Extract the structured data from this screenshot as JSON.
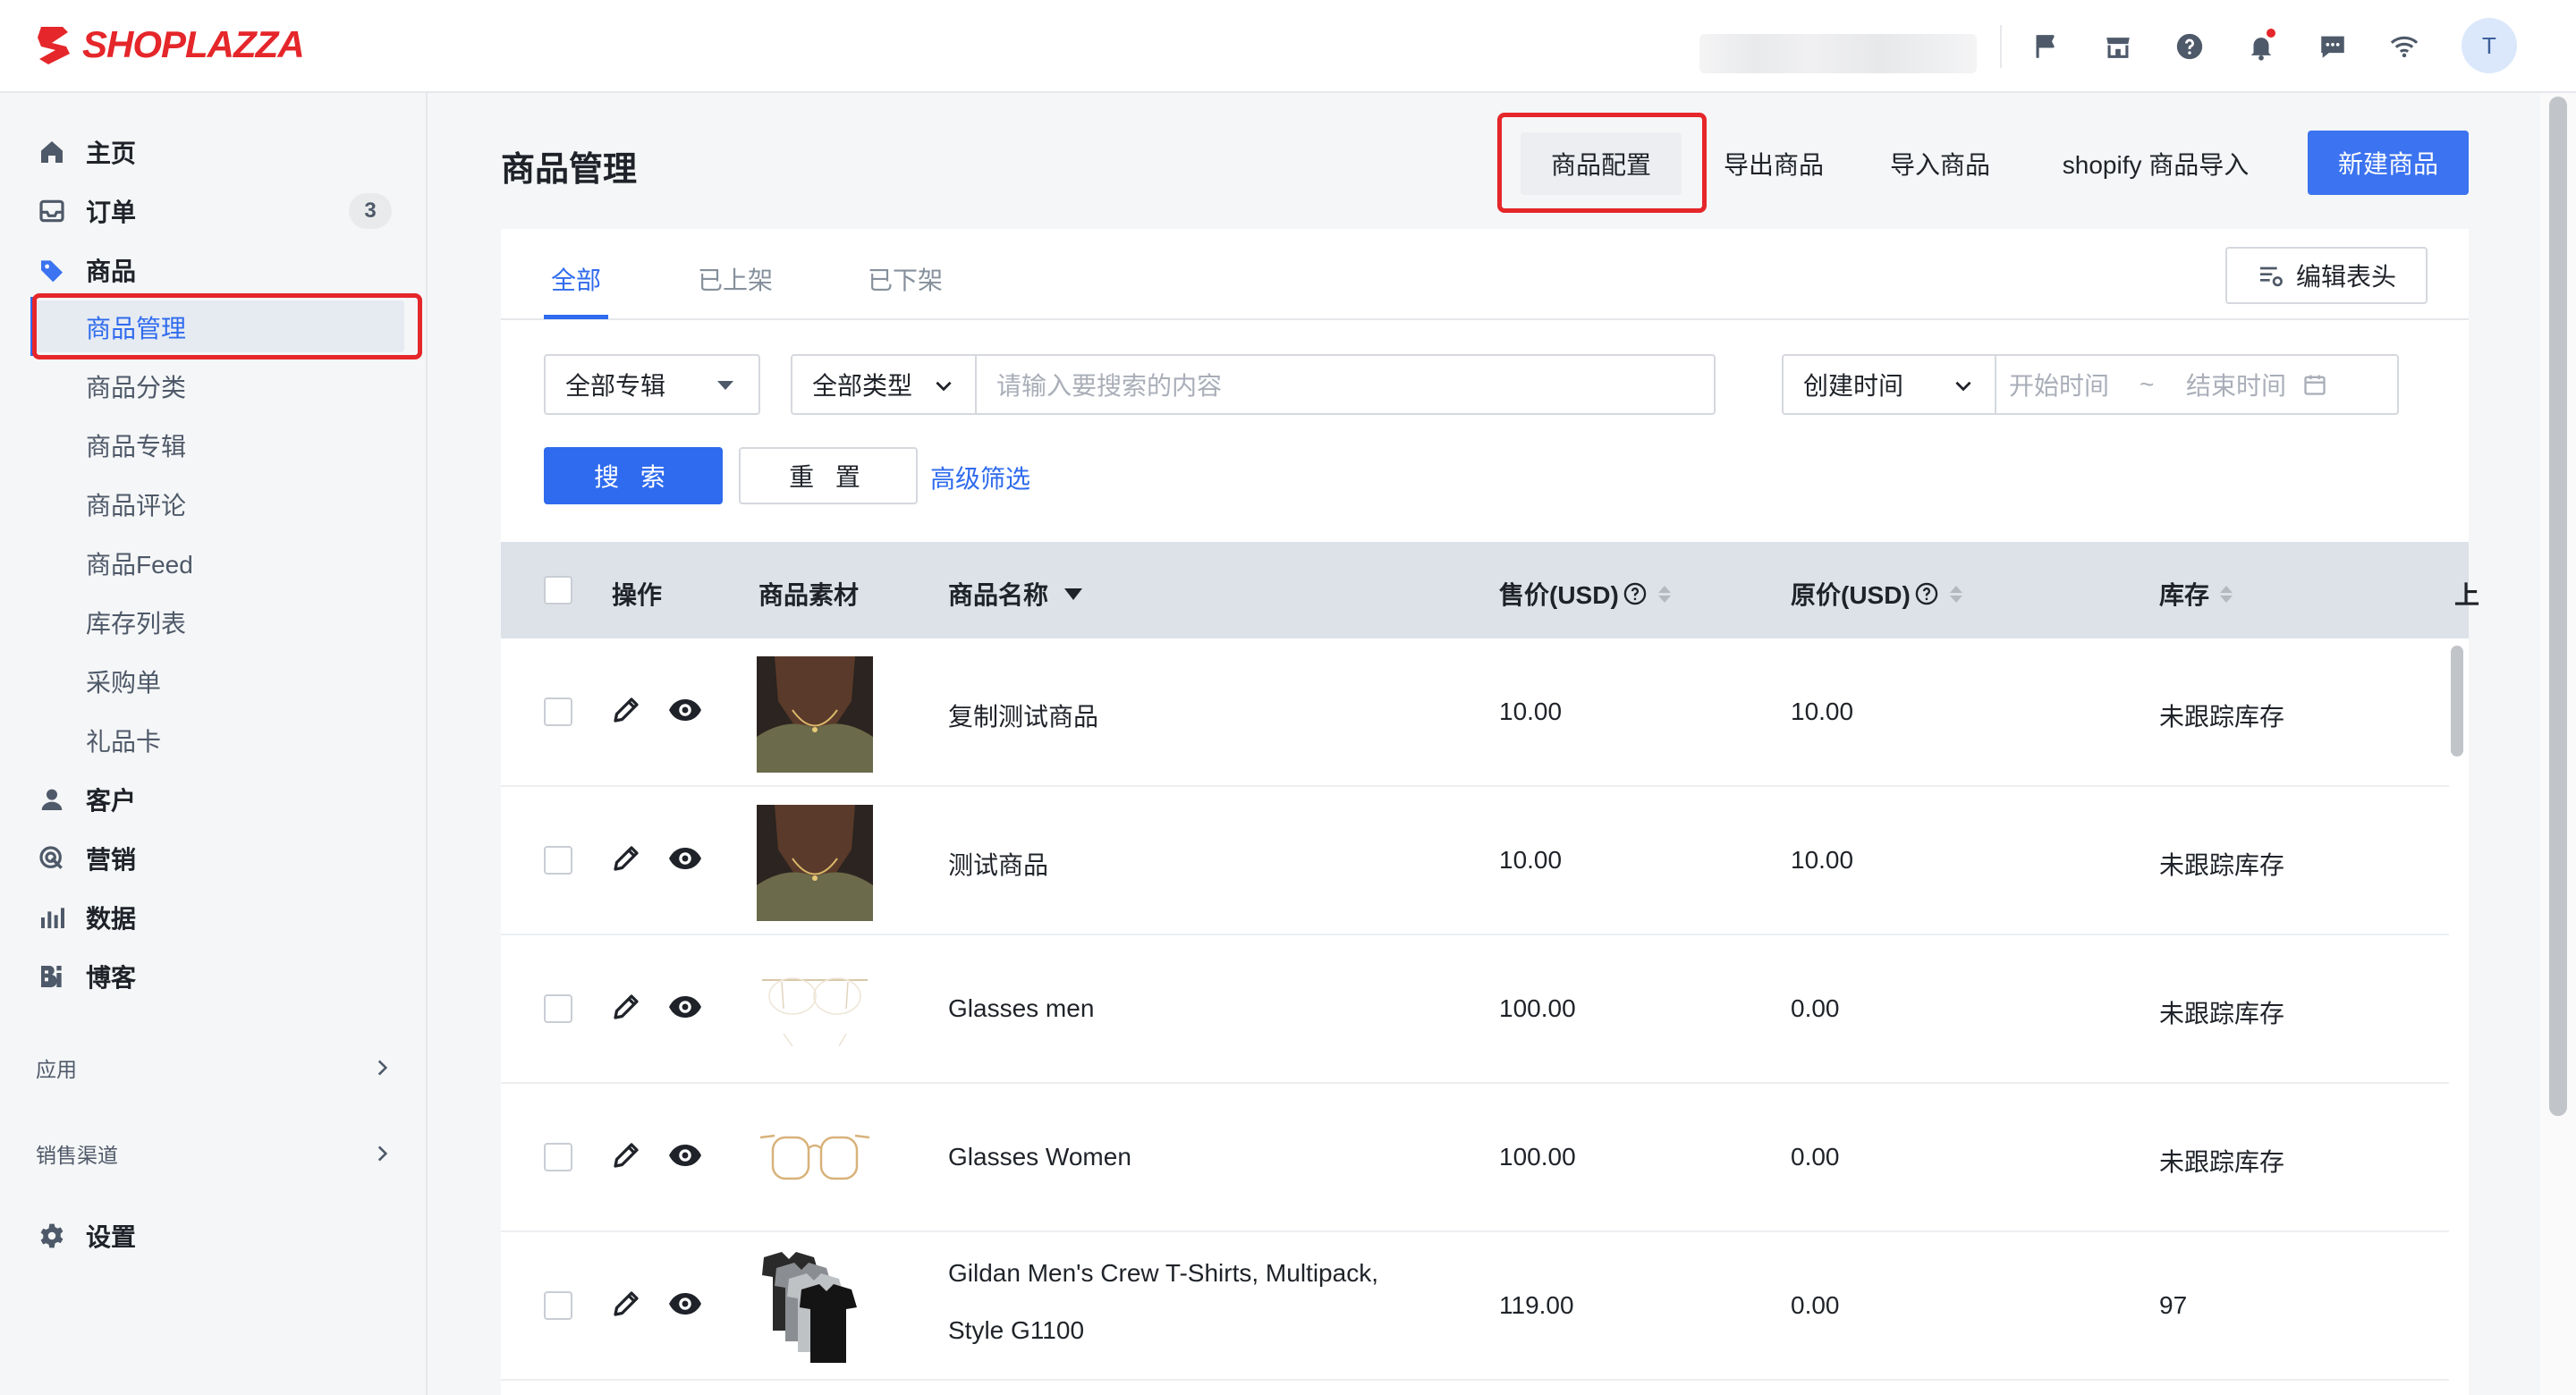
{
  "brand": {
    "name": "SHOPLAZZA",
    "color": "#e5262a"
  },
  "topbar": {
    "icons": [
      "flag-icon",
      "store-icon",
      "help-icon",
      "bell-icon",
      "message-icon",
      "wifi-icon"
    ],
    "avatar_initial": "T"
  },
  "sidebar": {
    "items": [
      {
        "label": "主页",
        "icon": "home-icon"
      },
      {
        "label": "订单",
        "icon": "inbox-icon",
        "badge": "3"
      },
      {
        "label": "商品",
        "icon": "tag-icon"
      },
      {
        "label": "客户",
        "icon": "user-icon"
      },
      {
        "label": "营销",
        "icon": "target-icon"
      },
      {
        "label": "数据",
        "icon": "chart-icon"
      },
      {
        "label": "博客",
        "icon": "blog-icon"
      }
    ],
    "product_sub": [
      "商品管理",
      "商品分类",
      "商品专辑",
      "商品评论",
      "商品Feed",
      "库存列表",
      "采购单",
      "礼品卡"
    ],
    "sections": [
      "应用",
      "销售渠道"
    ],
    "settings": {
      "label": "设置",
      "icon": "gear-icon"
    }
  },
  "header": {
    "title": "商品管理",
    "actions": [
      "商品配置",
      "导出商品",
      "导入商品",
      "shopify 商品导入"
    ],
    "new_button": "新建商品"
  },
  "tabs": [
    "全部",
    "已上架",
    "已下架"
  ],
  "edit_header_button": "编辑表头",
  "filters": {
    "collection": "全部专辑",
    "type": "全部类型",
    "search_placeholder": "请输入要搜索的内容",
    "time_field": "创建时间",
    "start_placeholder": "开始时间",
    "separator": "~",
    "end_placeholder": "结束时间",
    "search_button": "搜 索",
    "reset_button": "重 置",
    "advanced_link": "高级筛选"
  },
  "table": {
    "columns": [
      "操作",
      "商品素材",
      "商品名称",
      "售价(USD)",
      "原价(USD)",
      "库存",
      "上"
    ],
    "rows": [
      {
        "name": "复制测试商品",
        "name2": "",
        "price": "10.00",
        "original": "10.00",
        "stock": "未跟踪库存",
        "image": "necklace"
      },
      {
        "name": "测试商品",
        "name2": "",
        "price": "10.00",
        "original": "10.00",
        "stock": "未跟踪库存",
        "image": "necklace"
      },
      {
        "name": "Glasses men",
        "name2": "",
        "price": "100.00",
        "original": "0.00",
        "stock": "未跟踪库存",
        "image": "rimless-glasses"
      },
      {
        "name": "Glasses Women",
        "name2": "",
        "price": "100.00",
        "original": "0.00",
        "stock": "未跟踪库存",
        "image": "gold-glasses"
      },
      {
        "name": "Gildan Men's Crew T-Shirts, Multipack,",
        "name2": "Style G1100",
        "price": "119.00",
        "original": "0.00",
        "stock": "97",
        "image": "tshirts"
      }
    ]
  },
  "colors": {
    "primary": "#2f6bee",
    "highlight": "#e5262a",
    "header_bg": "#dde1e8"
  }
}
